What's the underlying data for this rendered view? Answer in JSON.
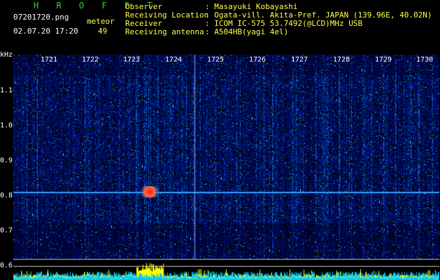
{
  "header": {
    "app_title": "H R O F F T",
    "filename": "07201720.png",
    "datetime": "02.07.20 17:20",
    "meteor_label": "meteor",
    "meteor_count": "49",
    "observer_label": "Observer",
    "observer_value": ": Masayuki Kobayashi",
    "location_label": "Receiving Location",
    "location_value": ": Ogata-vill. Akita-Pref. JAPAN (139.96E, 40.02N)",
    "receiver_label": "Receiver",
    "receiver_value": ": ICOM IC-575 53.7492(@LCD)MHz USB",
    "antenna_label": "Receiving antenna",
    "antenna_value": ": A504HB(yagi 4el)"
  },
  "axis": {
    "y_unit": "kHz",
    "y_ticks": [
      "1.1",
      "1.0",
      "0.9",
      "0.8",
      "0.7",
      "0.6"
    ],
    "x_ticks": [
      "1721",
      "1722",
      "1723",
      "1724",
      "1725",
      "1726",
      "1727",
      "1728",
      "1729",
      "1730"
    ]
  },
  "colors": {
    "background": "#000000",
    "spectrogram_base": "#0a1a6e",
    "carrier_line": "#29a3ff",
    "meteor_hot": "#ff2a2a",
    "level_trace": "#ffff00",
    "noise_trace": "#00c8ff"
  }
}
